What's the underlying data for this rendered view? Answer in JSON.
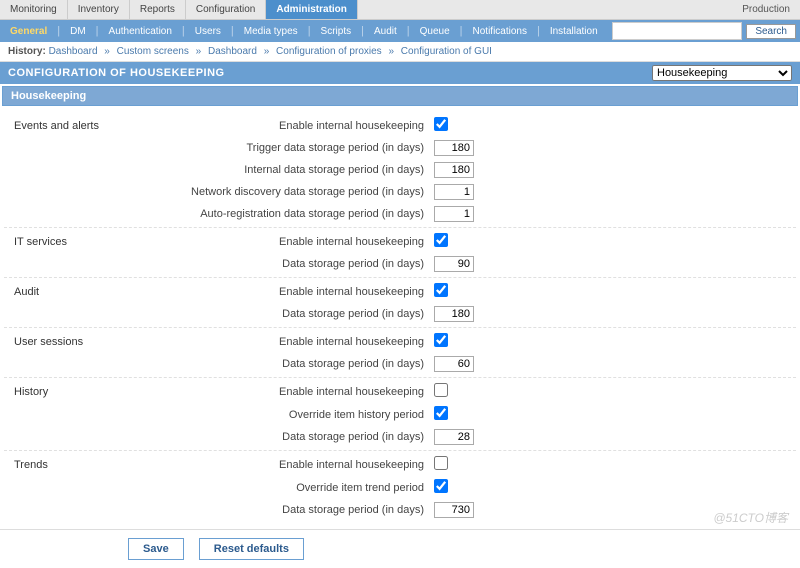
{
  "env": "Production",
  "top_tabs": [
    "Monitoring",
    "Inventory",
    "Reports",
    "Configuration",
    "Administration"
  ],
  "active_top_tab": 4,
  "sub_tabs": [
    "General",
    "DM",
    "Authentication",
    "Users",
    "Media types",
    "Scripts",
    "Audit",
    "Queue",
    "Notifications",
    "Installation"
  ],
  "search": {
    "placeholder": "",
    "button": "Search"
  },
  "history": {
    "label": "History:",
    "crumbs": [
      "Dashboard",
      "Custom screens",
      "Dashboard",
      "Configuration of proxies",
      "Configuration of GUI"
    ]
  },
  "page_title": "CONFIGURATION OF HOUSEKEEPING",
  "dropdown_selected": "Housekeeping",
  "section_title": "Housekeeping",
  "groups": [
    {
      "name": "Events and alerts",
      "fields": [
        {
          "label": "Enable internal housekeeping",
          "type": "checkbox",
          "checked": true
        },
        {
          "label": "Trigger data storage period (in days)",
          "type": "text",
          "value": "180"
        },
        {
          "label": "Internal data storage period (in days)",
          "type": "text",
          "value": "180"
        },
        {
          "label": "Network discovery data storage period (in days)",
          "type": "text",
          "value": "1"
        },
        {
          "label": "Auto-registration data storage period (in days)",
          "type": "text",
          "value": "1"
        }
      ]
    },
    {
      "name": "IT services",
      "fields": [
        {
          "label": "Enable internal housekeeping",
          "type": "checkbox",
          "checked": true
        },
        {
          "label": "Data storage period (in days)",
          "type": "text",
          "value": "90"
        }
      ]
    },
    {
      "name": "Audit",
      "fields": [
        {
          "label": "Enable internal housekeeping",
          "type": "checkbox",
          "checked": true
        },
        {
          "label": "Data storage period (in days)",
          "type": "text",
          "value": "180"
        }
      ]
    },
    {
      "name": "User sessions",
      "fields": [
        {
          "label": "Enable internal housekeeping",
          "type": "checkbox",
          "checked": true
        },
        {
          "label": "Data storage period (in days)",
          "type": "text",
          "value": "60"
        }
      ]
    },
    {
      "name": "History",
      "fields": [
        {
          "label": "Enable internal housekeeping",
          "type": "checkbox",
          "checked": false
        },
        {
          "label": "Override item history period",
          "type": "checkbox",
          "checked": true
        },
        {
          "label": "Data storage period (in days)",
          "type": "text",
          "value": "28"
        }
      ]
    },
    {
      "name": "Trends",
      "fields": [
        {
          "label": "Enable internal housekeeping",
          "type": "checkbox",
          "checked": false
        },
        {
          "label": "Override item trend period",
          "type": "checkbox",
          "checked": true
        },
        {
          "label": "Data storage period (in days)",
          "type": "text",
          "value": "730"
        }
      ]
    }
  ],
  "buttons": {
    "save": "Save",
    "reset": "Reset defaults"
  },
  "watermark": "@51CTO博客"
}
